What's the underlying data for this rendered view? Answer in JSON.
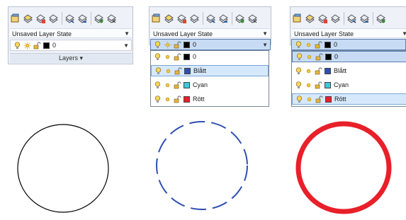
{
  "state_label": "Unsaved Layer State",
  "panel1": {
    "current_layer": "0",
    "footer_label": "Layers",
    "footer_arrow": "▾"
  },
  "panel2": {
    "current_layer": "0",
    "items": [
      {
        "name": "0",
        "color": "#000000"
      },
      {
        "name": "Blått",
        "color": "#2f4fb0"
      },
      {
        "name": "Cyan",
        "color": "#3fc7d6"
      },
      {
        "name": "Rött",
        "color": "#e8202a"
      }
    ]
  },
  "panel3": {
    "current_layer": "0",
    "items": [
      {
        "name": "0",
        "color": "#000000"
      },
      {
        "name": "Blått",
        "color": "#2f4fb0"
      },
      {
        "name": "Cyan",
        "color": "#3fc7d6"
      },
      {
        "name": "Rött",
        "color": "#e8202a"
      }
    ]
  },
  "icons": [
    "layer-properties-icon",
    "layer-state-icon",
    "make-current-icon",
    "layer-isolate-icon",
    "layer-match-icon",
    "layer-previous-icon",
    "layer-freeze-icon",
    "layer-off-icon",
    "lightbulb-icon",
    "sun-icon",
    "lock-icon"
  ],
  "circles": [
    {
      "style": "solid",
      "color": "#000000"
    },
    {
      "style": "dashed",
      "color": "#2f4fb0"
    },
    {
      "style": "solid-thick",
      "color": "#e8202a"
    }
  ]
}
